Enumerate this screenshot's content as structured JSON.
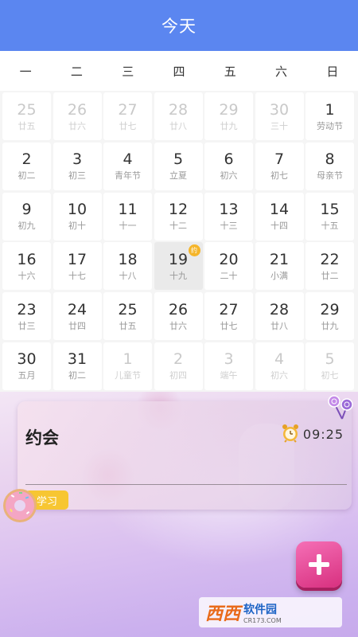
{
  "header": {
    "title": "今天"
  },
  "weekdays": [
    "一",
    "二",
    "三",
    "四",
    "五",
    "六",
    "日"
  ],
  "calendar": {
    "selected_day": "19",
    "days": [
      {
        "day": "25",
        "lunar": "廿五",
        "other": true
      },
      {
        "day": "26",
        "lunar": "廿六",
        "other": true
      },
      {
        "day": "27",
        "lunar": "廿七",
        "other": true
      },
      {
        "day": "28",
        "lunar": "廿八",
        "other": true
      },
      {
        "day": "29",
        "lunar": "廿九",
        "other": true
      },
      {
        "day": "30",
        "lunar": "三十",
        "other": true
      },
      {
        "day": "1",
        "lunar": "劳动节",
        "other": false
      },
      {
        "day": "2",
        "lunar": "初二",
        "other": false
      },
      {
        "day": "3",
        "lunar": "初三",
        "other": false
      },
      {
        "day": "4",
        "lunar": "青年节",
        "other": false
      },
      {
        "day": "5",
        "lunar": "立夏",
        "other": false
      },
      {
        "day": "6",
        "lunar": "初六",
        "other": false
      },
      {
        "day": "7",
        "lunar": "初七",
        "other": false
      },
      {
        "day": "8",
        "lunar": "母亲节",
        "other": false
      },
      {
        "day": "9",
        "lunar": "初九",
        "other": false
      },
      {
        "day": "10",
        "lunar": "初十",
        "other": false
      },
      {
        "day": "11",
        "lunar": "十一",
        "other": false
      },
      {
        "day": "12",
        "lunar": "十二",
        "other": false
      },
      {
        "day": "13",
        "lunar": "十三",
        "other": false
      },
      {
        "day": "14",
        "lunar": "十四",
        "other": false
      },
      {
        "day": "15",
        "lunar": "十五",
        "other": false
      },
      {
        "day": "16",
        "lunar": "十六",
        "other": false
      },
      {
        "day": "17",
        "lunar": "十七",
        "other": false
      },
      {
        "day": "18",
        "lunar": "十八",
        "other": false
      },
      {
        "day": "19",
        "lunar": "十九",
        "other": false,
        "badge": "约"
      },
      {
        "day": "20",
        "lunar": "二十",
        "other": false
      },
      {
        "day": "21",
        "lunar": "小满",
        "other": false
      },
      {
        "day": "22",
        "lunar": "廿二",
        "other": false
      },
      {
        "day": "23",
        "lunar": "廿三",
        "other": false
      },
      {
        "day": "24",
        "lunar": "廿四",
        "other": false
      },
      {
        "day": "25",
        "lunar": "廿五",
        "other": false
      },
      {
        "day": "26",
        "lunar": "廿六",
        "other": false
      },
      {
        "day": "27",
        "lunar": "廿七",
        "other": false
      },
      {
        "day": "28",
        "lunar": "廿八",
        "other": false
      },
      {
        "day": "29",
        "lunar": "廿九",
        "other": false
      },
      {
        "day": "30",
        "lunar": "五月",
        "other": false
      },
      {
        "day": "31",
        "lunar": "初二",
        "other": false
      },
      {
        "day": "1",
        "lunar": "儿童节",
        "other": true
      },
      {
        "day": "2",
        "lunar": "初四",
        "other": true
      },
      {
        "day": "3",
        "lunar": "端午",
        "other": true
      },
      {
        "day": "4",
        "lunar": "初六",
        "other": true
      },
      {
        "day": "5",
        "lunar": "初七",
        "other": true
      }
    ]
  },
  "event": {
    "title": "约会",
    "time": "09:25",
    "tag": "学习",
    "clock_icon": "alarm-clock-icon"
  },
  "watermark": {
    "logo": "西西",
    "title": "软件园",
    "sub": "CR173.COM"
  },
  "colors": {
    "header": "#5b86f0",
    "badge": "#f5b52a",
    "tag": "#f7c632",
    "add_button": "#e0408f"
  }
}
